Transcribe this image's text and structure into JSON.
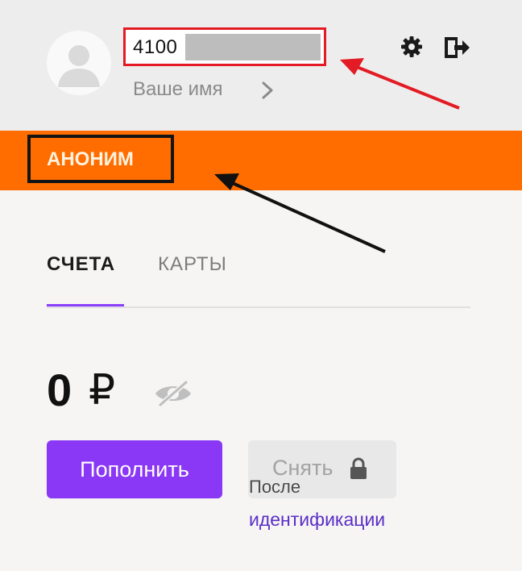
{
  "header": {
    "wallet_number": "4100",
    "user_name": "Ваше имя"
  },
  "status": {
    "label": "АНОНИМ"
  },
  "tabs": [
    {
      "label": "СЧЕТА",
      "active": true
    },
    {
      "label": "КАРТЫ",
      "active": false
    }
  ],
  "balance": {
    "amount": "0",
    "currency": "₽"
  },
  "actions": {
    "topup_label": "Пополнить",
    "withdraw_label": "Снять",
    "withdraw_note_line1": "После",
    "withdraw_note_link": "идентификации"
  },
  "icons": {
    "avatar": "user-placeholder-icon",
    "chevron": "chevron-right-icon",
    "settings": "gear-icon",
    "logout": "logout-icon",
    "visibility": "eye-off-icon",
    "lock": "lock-icon"
  },
  "colors": {
    "status_bar": "#ff6d00",
    "accent": "#8a38f5",
    "highlight_red": "#e21b24",
    "link": "#5b2fc7"
  }
}
